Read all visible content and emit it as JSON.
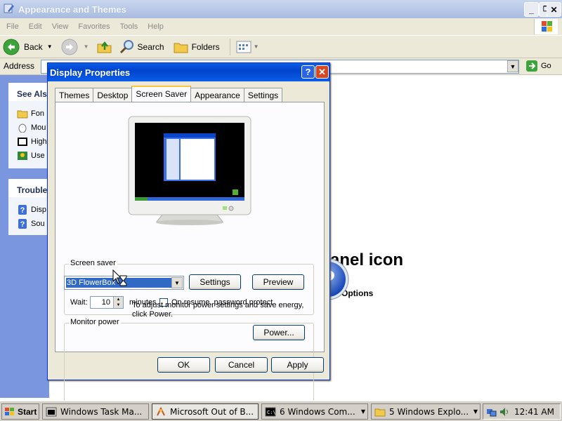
{
  "explorer": {
    "title": "Appearance and Themes",
    "menu": [
      "File",
      "Edit",
      "View",
      "Favorites",
      "Tools",
      "Help"
    ],
    "toolbar": {
      "back": "Back",
      "search": "Search",
      "folders": "Folders"
    },
    "address_label": "Address",
    "go_label": "Go"
  },
  "task_pane": {
    "see_also": {
      "heading": "See Als",
      "items": [
        "Fon",
        "Mou",
        "High",
        "Use"
      ]
    },
    "troubleshooters": {
      "heading": "Trouble",
      "items": [
        "Disp",
        "Sou"
      ]
    }
  },
  "background": {
    "big_text": "anel icon",
    "small_text": "r Options"
  },
  "dialog": {
    "title": "Display Properties",
    "help_btn": "?",
    "close_btn": "✕",
    "tabs": [
      "Themes",
      "Desktop",
      "Screen Saver",
      "Appearance",
      "Settings"
    ],
    "active_tab": "Screen Saver",
    "screensaver_group": "Screen saver",
    "screensaver_value": "3D FlowerBox",
    "settings_btn": "Settings",
    "preview_btn": "Preview",
    "wait_label": "Wait:",
    "wait_value": "10",
    "minutes_label": "minutes",
    "resume_label": "On resume, password protect",
    "monitor_group": "Monitor power",
    "monitor_text_1": "To adjust monitor power settings and save energy,",
    "monitor_text_2": "click Power.",
    "power_btn": "Power...",
    "ok_btn": "OK",
    "cancel_btn": "Cancel",
    "apply_btn": "Apply"
  },
  "taskbar": {
    "start": "Start",
    "tasks": [
      {
        "label": "Windows Task Ma..."
      },
      {
        "label": "Microsoft Out of B..."
      },
      {
        "label": "6 Windows Com..."
      },
      {
        "label": "5 Windows Explo..."
      }
    ],
    "clock": "12:41 AM"
  },
  "colors": {
    "titlebar_active": "#0a5ee8",
    "dialog_face": "#ece9d8",
    "task_pane_blue": "#7a96df",
    "selection": "#316ac5"
  }
}
